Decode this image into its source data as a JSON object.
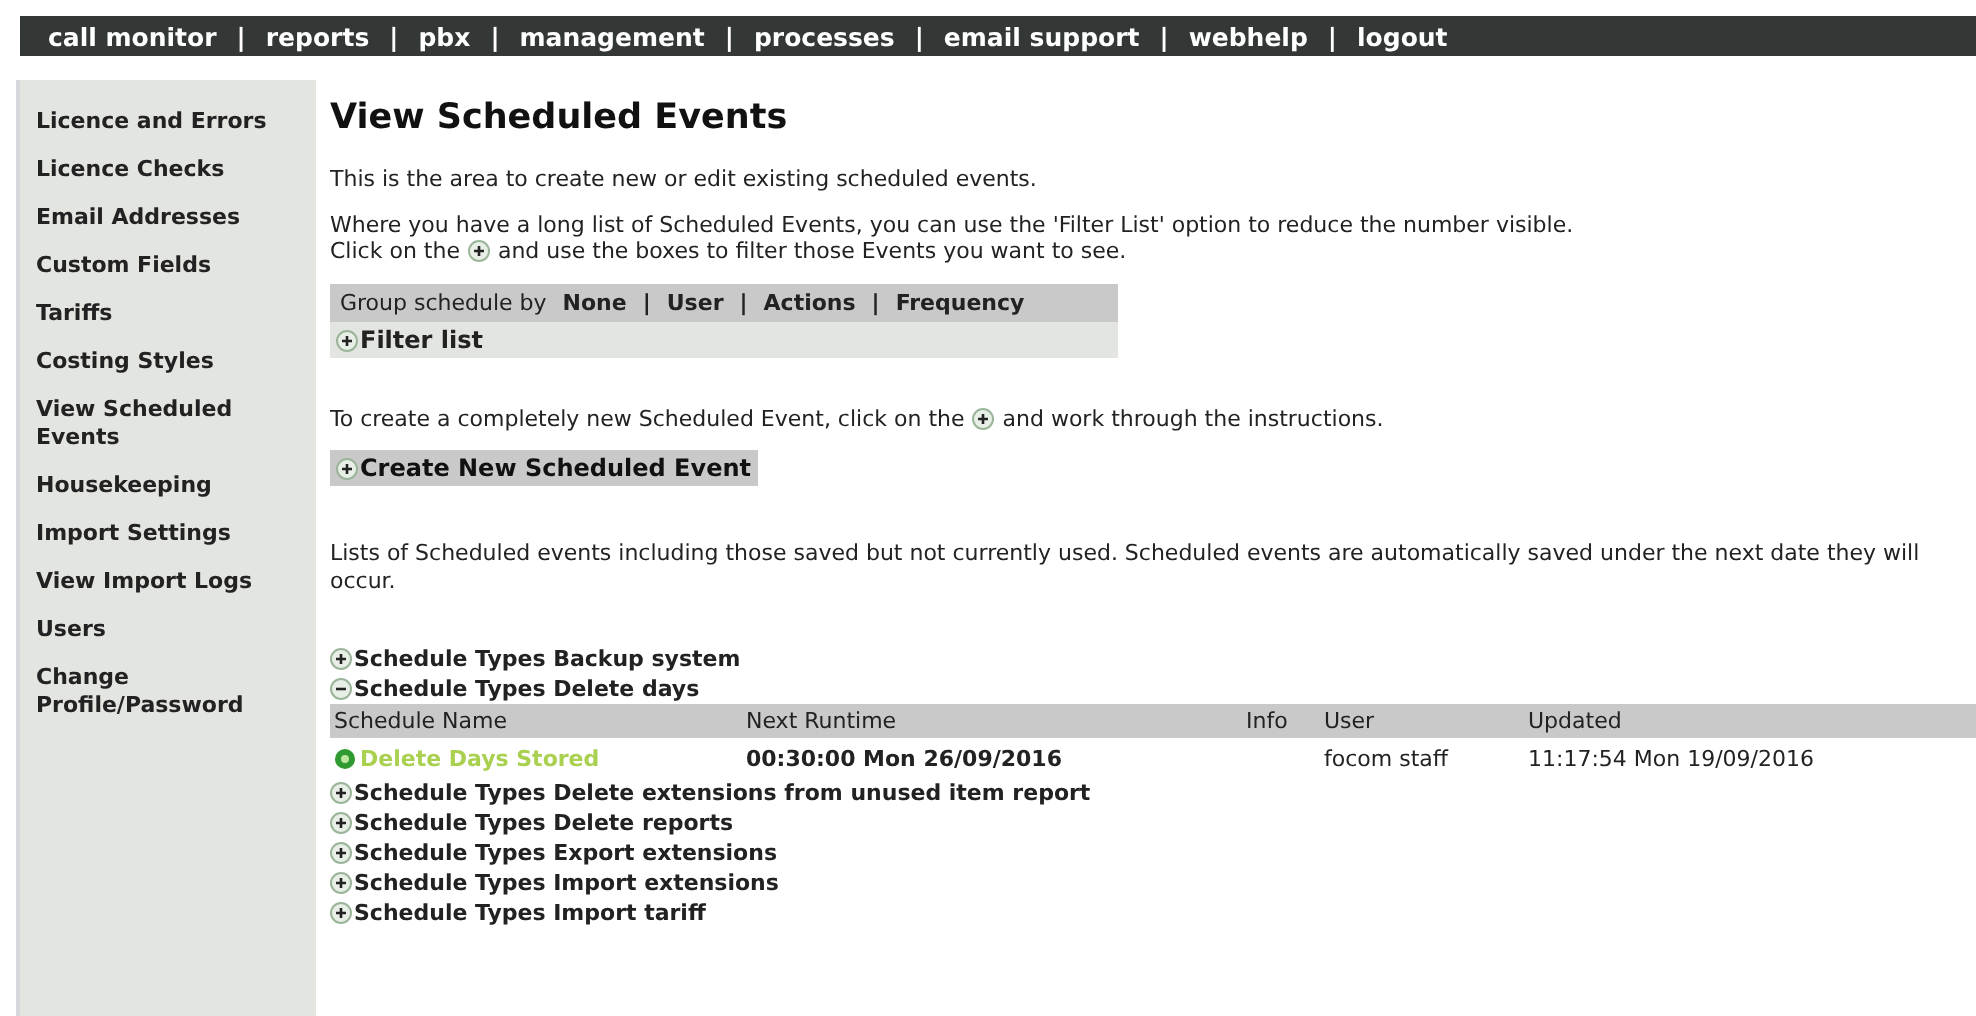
{
  "nav": {
    "separator": "|",
    "items": [
      {
        "label": "call monitor"
      },
      {
        "label": "reports"
      },
      {
        "label": "pbx"
      },
      {
        "label": "management"
      },
      {
        "label": "processes"
      },
      {
        "label": "email support"
      },
      {
        "label": "webhelp"
      },
      {
        "label": "logout"
      }
    ]
  },
  "sidebar": {
    "items": [
      {
        "label": "Licence and Errors"
      },
      {
        "label": "Licence Checks"
      },
      {
        "label": "Email Addresses"
      },
      {
        "label": "Custom Fields"
      },
      {
        "label": "Tariffs"
      },
      {
        "label": "Costing Styles"
      },
      {
        "label": "View Scheduled Events"
      },
      {
        "label": "Housekeeping"
      },
      {
        "label": "Import Settings"
      },
      {
        "label": "View Import Logs"
      },
      {
        "label": "Users"
      },
      {
        "label": "Change Profile/Password"
      }
    ]
  },
  "content": {
    "title": "View Scheduled Events",
    "intro": "This is the area to create new or edit existing scheduled events.",
    "filter_hint": "Where you have a long list of Scheduled Events, you can use the 'Filter List' option to reduce the number visible.",
    "filter_hint_before": "Click on the",
    "filter_hint_after": "and use the boxes to filter those Events you want to see.",
    "group_by": {
      "label": "Group schedule by",
      "separator": "|",
      "options": [
        {
          "label": "None"
        },
        {
          "label": "User"
        },
        {
          "label": "Actions"
        },
        {
          "label": "Frequency"
        }
      ]
    },
    "filter_list": "Filter list",
    "create_hint_before": "To create a completely new Scheduled Event, click on the",
    "create_hint_after": "and work through the instructions.",
    "create_button": "Create New Scheduled Event",
    "list_note": "Lists of Scheduled events including those saved but not currently used. Scheduled events are automatically saved under the next date they will occur.",
    "groups": [
      {
        "label": "Schedule Types Backup system",
        "expanded": false
      },
      {
        "label": "Schedule Types Delete days",
        "expanded": true,
        "columns": [
          "Schedule Name",
          "Next Runtime",
          "Info",
          "User",
          "Updated"
        ],
        "rows": [
          {
            "name": "Delete Days Stored",
            "next_runtime": "00:30:00 Mon 26/09/2016",
            "user": "focom staff",
            "updated": "11:17:54 Mon 19/09/2016"
          }
        ]
      },
      {
        "label": "Schedule Types Delete extensions from unused item report",
        "expanded": false
      },
      {
        "label": "Schedule Types Delete reports",
        "expanded": false
      },
      {
        "label": "Schedule Types Export extensions",
        "expanded": false
      },
      {
        "label": "Schedule Types Import extensions",
        "expanded": false
      },
      {
        "label": "Schedule Types Import tariff",
        "expanded": false
      }
    ]
  }
}
